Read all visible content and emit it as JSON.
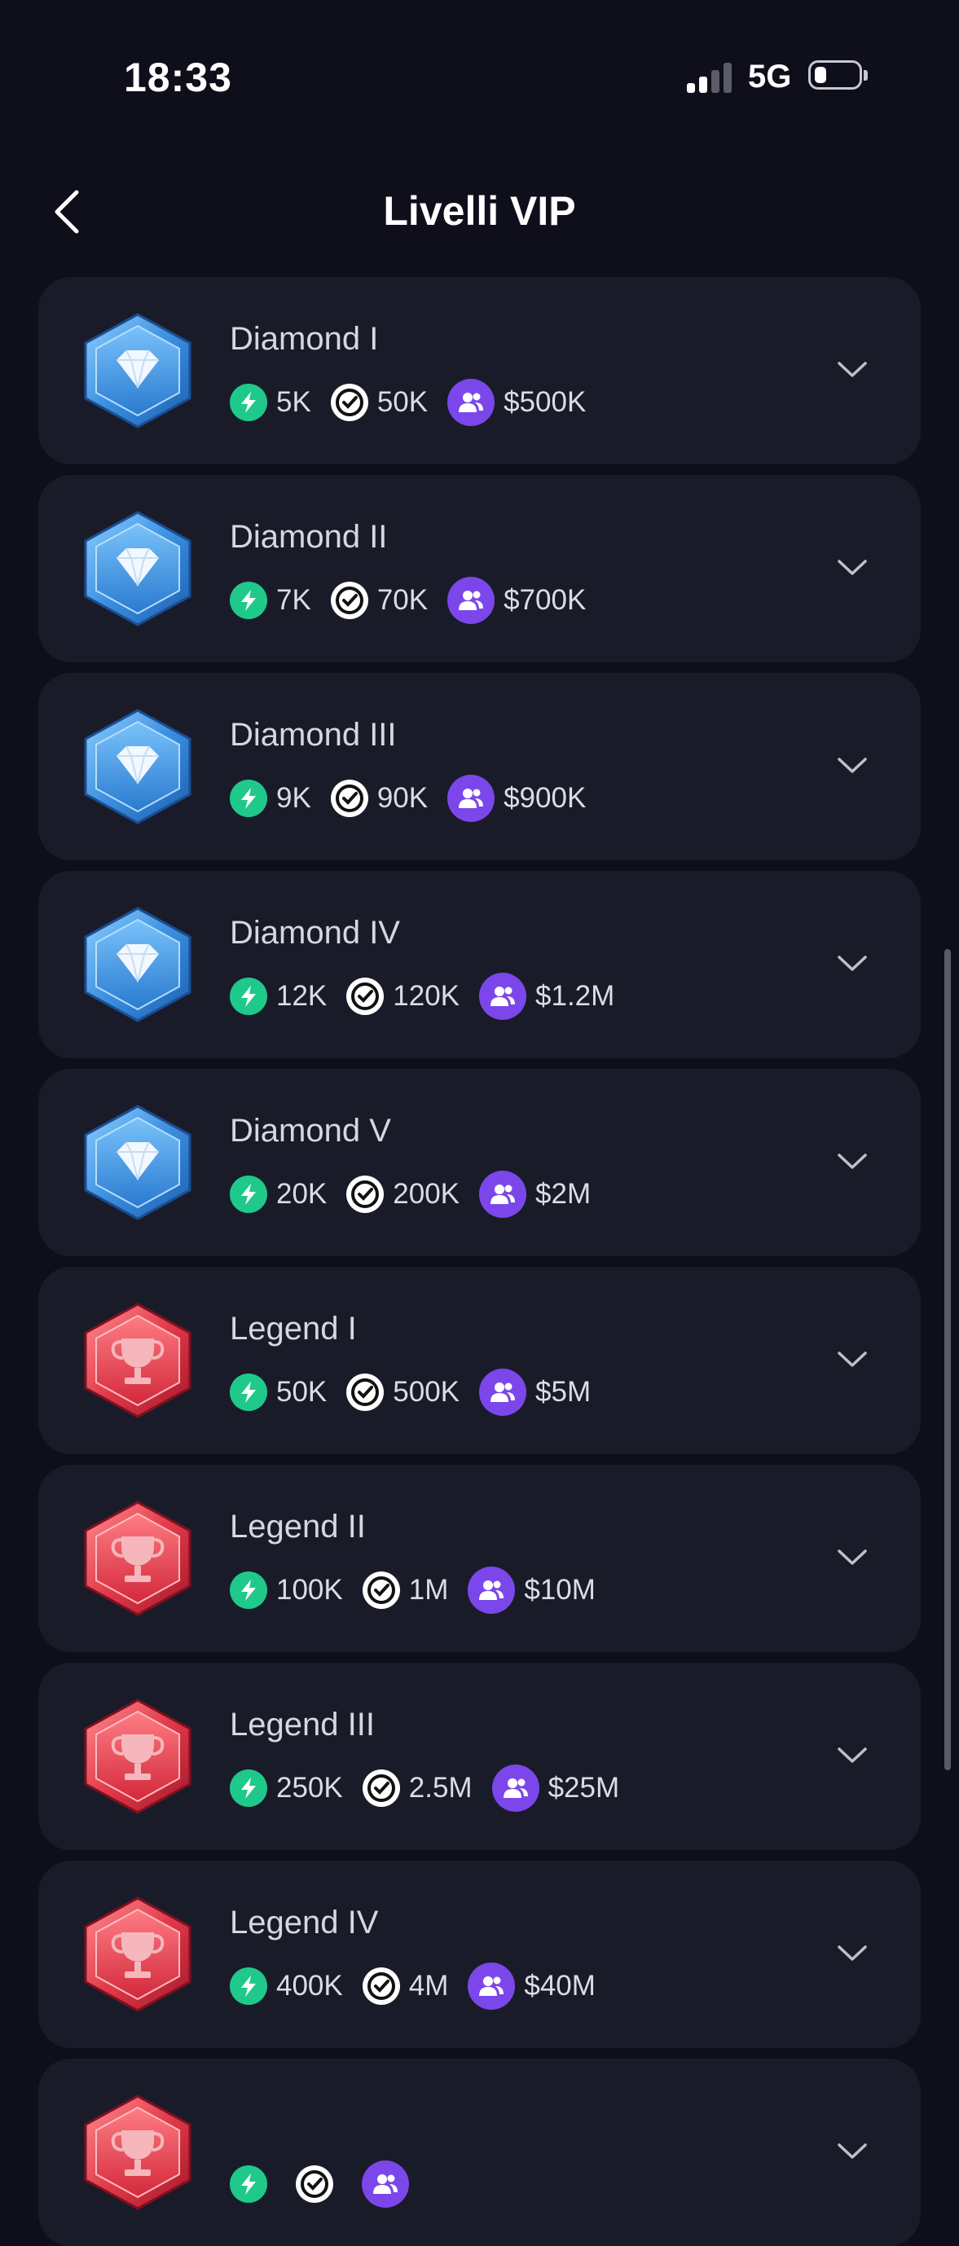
{
  "status_bar": {
    "time": "18:33",
    "network": "5G",
    "signal_bars": 2
  },
  "header": {
    "title": "Livelli VIP"
  },
  "icons": {
    "back": "chevron-left-icon",
    "expand": "chevron-down-icon",
    "stat1": "bolt-icon",
    "stat2": "coin-icon",
    "stat3": "users-icon"
  },
  "colors": {
    "background": "#0e0f1b",
    "card": "#1a1b29",
    "bolt": "#1fc98b",
    "users": "#7b47ea",
    "diamond_badge": "#2f86d6",
    "legend_badge": "#e23a4a"
  },
  "tiers": [
    {
      "name": "Diamond I",
      "badge": "diamond",
      "stat1": "5K",
      "stat2": "50K",
      "stat3": "$500K"
    },
    {
      "name": "Diamond II",
      "badge": "diamond",
      "stat1": "7K",
      "stat2": "70K",
      "stat3": "$700K"
    },
    {
      "name": "Diamond III",
      "badge": "diamond",
      "stat1": "9K",
      "stat2": "90K",
      "stat3": "$900K"
    },
    {
      "name": "Diamond IV",
      "badge": "diamond",
      "stat1": "12K",
      "stat2": "120K",
      "stat3": "$1.2M"
    },
    {
      "name": "Diamond V",
      "badge": "diamond",
      "stat1": "20K",
      "stat2": "200K",
      "stat3": "$2M"
    },
    {
      "name": "Legend I",
      "badge": "legend",
      "stat1": "50K",
      "stat2": "500K",
      "stat3": "$5M"
    },
    {
      "name": "Legend II",
      "badge": "legend",
      "stat1": "100K",
      "stat2": "1M",
      "stat3": "$10M"
    },
    {
      "name": "Legend III",
      "badge": "legend",
      "stat1": "250K",
      "stat2": "2.5M",
      "stat3": "$25M"
    },
    {
      "name": "Legend IV",
      "badge": "legend",
      "stat1": "400K",
      "stat2": "4M",
      "stat3": "$40M"
    },
    {
      "name": "",
      "badge": "legend",
      "stat1": "",
      "stat2": "",
      "stat3": ""
    }
  ]
}
